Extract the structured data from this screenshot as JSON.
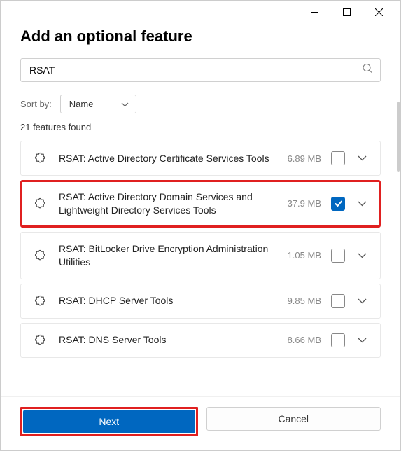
{
  "header": {
    "title": "Add an optional feature"
  },
  "search": {
    "value": "RSAT"
  },
  "sort": {
    "label": "Sort by:",
    "selected": "Name"
  },
  "count": {
    "label": "21 features found"
  },
  "features": [
    {
      "label": "RSAT: Active Directory Certificate Services Tools",
      "size": "6.89 MB",
      "checked": false,
      "highlighted": false
    },
    {
      "label": "RSAT: Active Directory Domain Services and Lightweight Directory Services Tools",
      "size": "37.9 MB",
      "checked": true,
      "highlighted": true
    },
    {
      "label": "RSAT: BitLocker Drive Encryption Administration Utilities",
      "size": "1.05 MB",
      "checked": false,
      "highlighted": false
    },
    {
      "label": "RSAT: DHCP Server Tools",
      "size": "9.85 MB",
      "checked": false,
      "highlighted": false
    },
    {
      "label": "RSAT: DNS Server Tools",
      "size": "8.66 MB",
      "checked": false,
      "highlighted": false
    }
  ],
  "footer": {
    "primary_label": "Next",
    "cancel_label": "Cancel"
  }
}
